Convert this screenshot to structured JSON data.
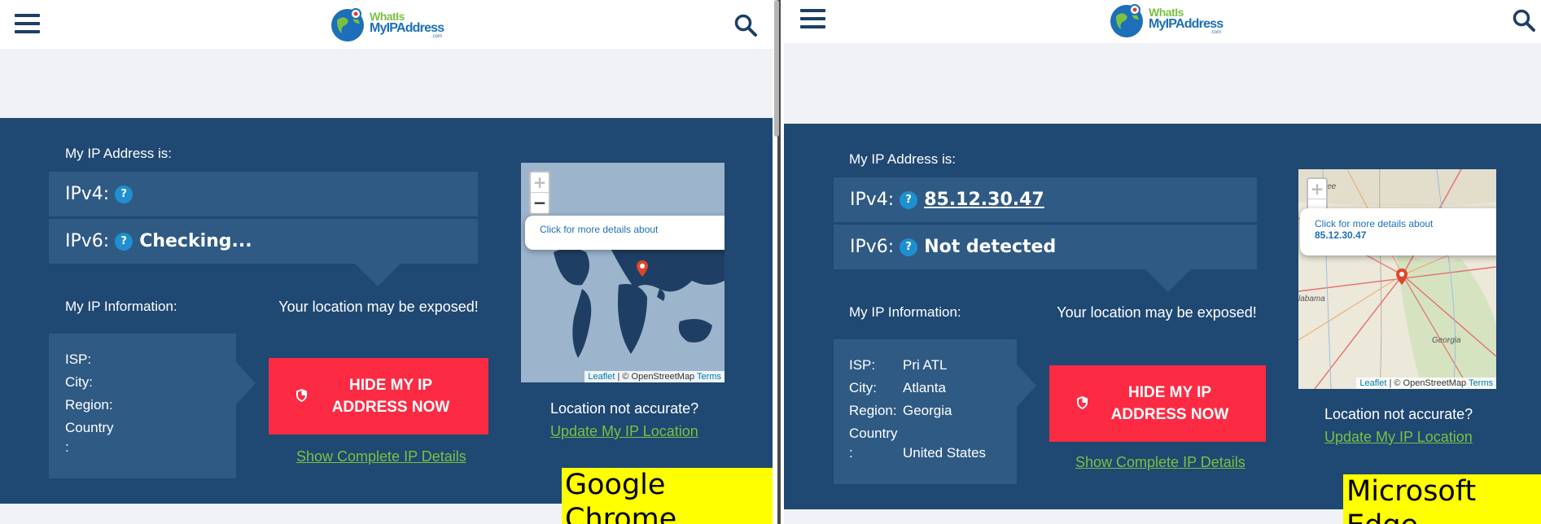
{
  "logo": {
    "line1": "WhatIs",
    "line2": "MyIPAddress",
    "line3": ".com"
  },
  "panels": {
    "chrome": {
      "browser_label": "Google Chrome",
      "my_ip_label": "My IP Address is:",
      "ipv4_key": "IPv4:",
      "ipv4_value": "",
      "ipv6_key": "IPv6:",
      "ipv6_value": "Checking...",
      "info_label": "My IP Information:",
      "isp_key": "ISP:",
      "isp_value": "",
      "city_key": "City:",
      "city_value": "",
      "region_key": "Region:",
      "region_value": "",
      "country_key": "Country",
      "country_colon": ":",
      "country_value": "",
      "exposed_text": "Your location may be exposed!",
      "hide_button": "HIDE MY IP ADDRESS NOW",
      "show_details": "Show Complete IP Details",
      "map_popup": "Click for more details about",
      "map_popup_ip": "",
      "attrib_leaflet": "Leaflet",
      "attrib_osm": " | © OpenStreetMap ",
      "attrib_terms": "Terms",
      "not_accurate": "Location not accurate?",
      "update_location": "Update My IP Location"
    },
    "edge": {
      "browser_label": "Microsoft Edge",
      "my_ip_label": "My IP Address is:",
      "ipv4_key": "IPv4:",
      "ipv4_value": "85.12.30.47",
      "ipv6_key": "IPv6:",
      "ipv6_value": "Not detected",
      "info_label": "My IP Information:",
      "isp_key": "ISP:",
      "isp_value": "Pri ATL",
      "city_key": "City:",
      "city_value": "Atlanta",
      "region_key": "Region:",
      "region_value": "Georgia",
      "country_key": "Country",
      "country_colon": ":",
      "country_value": "United States",
      "exposed_text": "Your location may be exposed!",
      "hide_button": "HIDE MY IP ADDRESS NOW",
      "show_details": "Show Complete IP Details",
      "map_popup": "Click for more details about",
      "map_popup_ip": "85.12.30.47",
      "map_label_tennessee": "nessee",
      "map_label_alabama": "labama",
      "map_label_georgia": "Georgia",
      "attrib_leaflet": "Leaflet",
      "attrib_osm": " | © OpenStreetMap ",
      "attrib_terms": "Terms",
      "not_accurate": "Location not accurate?",
      "update_location": "Update My IP Location"
    }
  },
  "icons": {
    "menu": "hamburger-menu-icon",
    "search": "search-icon",
    "help": "question-mark-icon",
    "shield": "shield-icon",
    "map_marker": "map-marker-icon"
  },
  "colors": {
    "panel_bg": "#1f4872",
    "row_bg": "#2f5a84",
    "hide_button": "#fc2b43",
    "link_green": "#7ac143",
    "label_highlight": "#ffff00"
  }
}
